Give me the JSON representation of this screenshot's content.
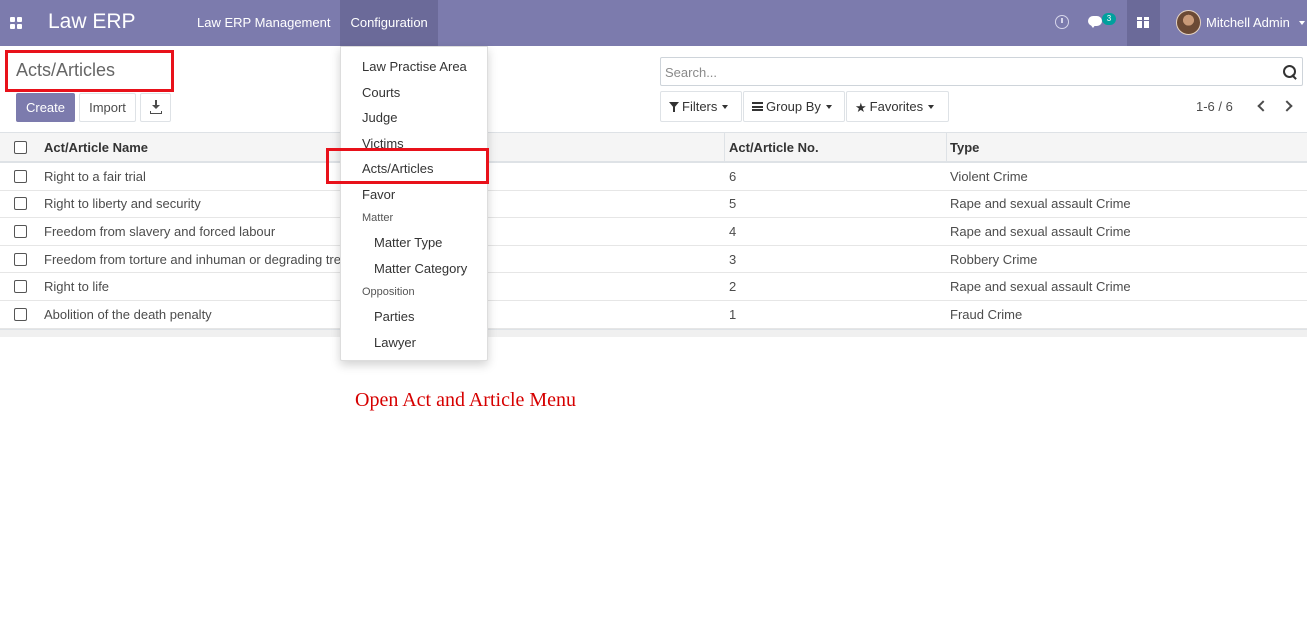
{
  "navbar": {
    "brand": "Law ERP",
    "menus": [
      {
        "label": "Law ERP Management"
      },
      {
        "label": "Configuration"
      }
    ],
    "chat_badge": "3",
    "user_name": "Mitchell Admin",
    "accent_color": "#7c7bad"
  },
  "control_panel": {
    "title": "Acts/Articles",
    "create_label": "Create",
    "import_label": "Import",
    "search_placeholder": "Search...",
    "filters_label": "Filters",
    "groupby_label": "Group By",
    "favorites_label": "Favorites",
    "pager": "1-6 / 6"
  },
  "list": {
    "columns": [
      "Act/Article Name",
      "Act/Article No.",
      "Type"
    ],
    "rows": [
      {
        "name": "Right to a fair trial",
        "no": "6",
        "type": "Violent Crime"
      },
      {
        "name": "Right to liberty and security",
        "no": "5",
        "type": "Rape and sexual assault Crime"
      },
      {
        "name": "Freedom from slavery and forced labour",
        "no": "4",
        "type": "Rape and sexual assault Crime"
      },
      {
        "name": "Freedom from torture and inhuman or degrading treatment",
        "no": "3",
        "type": "Robbery Crime"
      },
      {
        "name": "Right to life",
        "no": "2",
        "type": "Rape and sexual assault Crime"
      },
      {
        "name": "Abolition of the death penalty",
        "no": "1",
        "type": "Fraud Crime"
      }
    ]
  },
  "configuration_menu": {
    "items": [
      "Law Practise Area",
      "Courts",
      "Judge",
      "Victims",
      "Acts/Articles",
      "Favor"
    ],
    "matter_header": "Matter",
    "matter_items": [
      "Matter Type",
      "Matter Category"
    ],
    "opposition_header": "Opposition",
    "opposition_items": [
      "Parties",
      "Lawyer"
    ]
  },
  "annotation": "Open Act and Article Menu",
  "highlight_color": "#e8111a"
}
